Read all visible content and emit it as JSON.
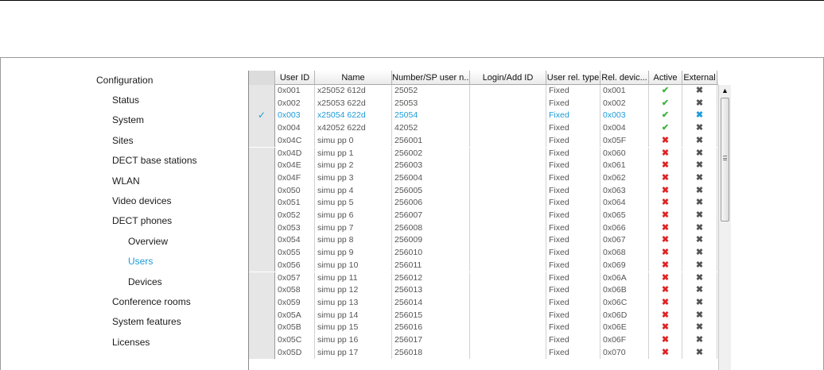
{
  "nav": {
    "root": "Configuration",
    "items": [
      {
        "label": "Status",
        "level": 1
      },
      {
        "label": "System",
        "level": 1
      },
      {
        "label": "Sites",
        "level": 1
      },
      {
        "label": "DECT base stations",
        "level": 1
      },
      {
        "label": "WLAN",
        "level": 1
      },
      {
        "label": "Video devices",
        "level": 1
      },
      {
        "label": "DECT phones",
        "level": 1
      },
      {
        "label": "Overview",
        "level": 2
      },
      {
        "label": "Users",
        "level": 2,
        "active": true
      },
      {
        "label": "Devices",
        "level": 2
      },
      {
        "label": "Conference rooms",
        "level": 1
      },
      {
        "label": "System features",
        "level": 1
      },
      {
        "label": "Licenses",
        "level": 1
      }
    ]
  },
  "grid": {
    "columns": [
      "",
      "User ID",
      "Name",
      "Number/SP user n...",
      "Login/Add ID",
      "User rel. type",
      "Rel. devic...",
      "Active",
      "External"
    ],
    "rows": [
      {
        "checked": false,
        "user_id": "0x001",
        "name": "x25052  612d",
        "number": "25052",
        "login": "",
        "rel_type": "Fixed",
        "rel_device": "0x001",
        "active": "✔",
        "active_state": "ok",
        "external": "✖"
      },
      {
        "checked": false,
        "user_id": "0x002",
        "name": "x25053  622d",
        "number": "25053",
        "login": "",
        "rel_type": "Fixed",
        "rel_device": "0x002",
        "active": "✔",
        "active_state": "ok",
        "external": "✖"
      },
      {
        "checked": true,
        "user_id": "0x003",
        "name": "x25054  622d",
        "number": "25054",
        "login": "",
        "rel_type": "Fixed",
        "rel_device": "0x003",
        "active": "✔",
        "active_state": "ok",
        "external": "✖"
      },
      {
        "checked": false,
        "user_id": "0x004",
        "name": "x42052  622d",
        "number": "42052",
        "login": "",
        "rel_type": "Fixed",
        "rel_device": "0x004",
        "active": "✔",
        "active_state": "ok",
        "external": "✖"
      },
      {
        "checked": false,
        "user_id": "0x04C",
        "name": "simu pp 0",
        "number": "256001",
        "login": "",
        "rel_type": "Fixed",
        "rel_device": "0x05F",
        "active": "✖",
        "active_state": "no",
        "external": "✖"
      },
      {
        "checked": false,
        "user_id": "0x04D",
        "name": "simu pp 1",
        "number": "256002",
        "login": "",
        "rel_type": "Fixed",
        "rel_device": "0x060",
        "active": "✖",
        "active_state": "no",
        "external": "✖"
      },
      {
        "checked": false,
        "user_id": "0x04E",
        "name": "simu pp 2",
        "number": "256003",
        "login": "",
        "rel_type": "Fixed",
        "rel_device": "0x061",
        "active": "✖",
        "active_state": "no",
        "external": "✖"
      },
      {
        "checked": false,
        "user_id": "0x04F",
        "name": "simu pp 3",
        "number": "256004",
        "login": "",
        "rel_type": "Fixed",
        "rel_device": "0x062",
        "active": "✖",
        "active_state": "no",
        "external": "✖"
      },
      {
        "checked": false,
        "user_id": "0x050",
        "name": "simu pp 4",
        "number": "256005",
        "login": "",
        "rel_type": "Fixed",
        "rel_device": "0x063",
        "active": "✖",
        "active_state": "no",
        "external": "✖"
      },
      {
        "checked": false,
        "user_id": "0x051",
        "name": "simu pp 5",
        "number": "256006",
        "login": "",
        "rel_type": "Fixed",
        "rel_device": "0x064",
        "active": "✖",
        "active_state": "no",
        "external": "✖"
      },
      {
        "checked": false,
        "user_id": "0x052",
        "name": "simu pp 6",
        "number": "256007",
        "login": "",
        "rel_type": "Fixed",
        "rel_device": "0x065",
        "active": "✖",
        "active_state": "no",
        "external": "✖"
      },
      {
        "checked": false,
        "user_id": "0x053",
        "name": "simu pp 7",
        "number": "256008",
        "login": "",
        "rel_type": "Fixed",
        "rel_device": "0x066",
        "active": "✖",
        "active_state": "no",
        "external": "✖"
      },
      {
        "checked": false,
        "user_id": "0x054",
        "name": "simu pp 8",
        "number": "256009",
        "login": "",
        "rel_type": "Fixed",
        "rel_device": "0x067",
        "active": "✖",
        "active_state": "no",
        "external": "✖"
      },
      {
        "checked": false,
        "user_id": "0x055",
        "name": "simu pp 9",
        "number": "256010",
        "login": "",
        "rel_type": "Fixed",
        "rel_device": "0x068",
        "active": "✖",
        "active_state": "no",
        "external": "✖"
      },
      {
        "checked": false,
        "user_id": "0x056",
        "name": "simu pp 10",
        "number": "256011",
        "login": "",
        "rel_type": "Fixed",
        "rel_device": "0x069",
        "active": "✖",
        "active_state": "no",
        "external": "✖"
      },
      {
        "checked": false,
        "user_id": "0x057",
        "name": "simu pp 11",
        "number": "256012",
        "login": "",
        "rel_type": "Fixed",
        "rel_device": "0x06A",
        "active": "✖",
        "active_state": "no",
        "external": "✖"
      },
      {
        "checked": false,
        "user_id": "0x058",
        "name": "simu pp 12",
        "number": "256013",
        "login": "",
        "rel_type": "Fixed",
        "rel_device": "0x06B",
        "active": "✖",
        "active_state": "no",
        "external": "✖"
      },
      {
        "checked": false,
        "user_id": "0x059",
        "name": "simu pp 13",
        "number": "256014",
        "login": "",
        "rel_type": "Fixed",
        "rel_device": "0x06C",
        "active": "✖",
        "active_state": "no",
        "external": "✖"
      },
      {
        "checked": false,
        "user_id": "0x05A",
        "name": "simu pp 14",
        "number": "256015",
        "login": "",
        "rel_type": "Fixed",
        "rel_device": "0x06D",
        "active": "✖",
        "active_state": "no",
        "external": "✖"
      },
      {
        "checked": false,
        "user_id": "0x05B",
        "name": "simu pp 15",
        "number": "256016",
        "login": "",
        "rel_type": "Fixed",
        "rel_device": "0x06E",
        "active": "✖",
        "active_state": "no",
        "external": "✖"
      },
      {
        "checked": false,
        "user_id": "0x05C",
        "name": "simu pp 16",
        "number": "256017",
        "login": "",
        "rel_type": "Fixed",
        "rel_device": "0x06F",
        "active": "✖",
        "active_state": "no",
        "external": "✖"
      },
      {
        "checked": false,
        "user_id": "0x05D",
        "name": "simu pp 17",
        "number": "256018",
        "login": "",
        "rel_type": "Fixed",
        "rel_device": "0x070",
        "active": "✖",
        "active_state": "no",
        "external": "✖"
      }
    ]
  },
  "scrollbar": {
    "up_arrow": "▲",
    "grip_icon": "scroll-grip"
  },
  "colors": {
    "accent": "#1c9bd8",
    "active_ok": "#3cb43c",
    "active_no": "#e02424"
  }
}
